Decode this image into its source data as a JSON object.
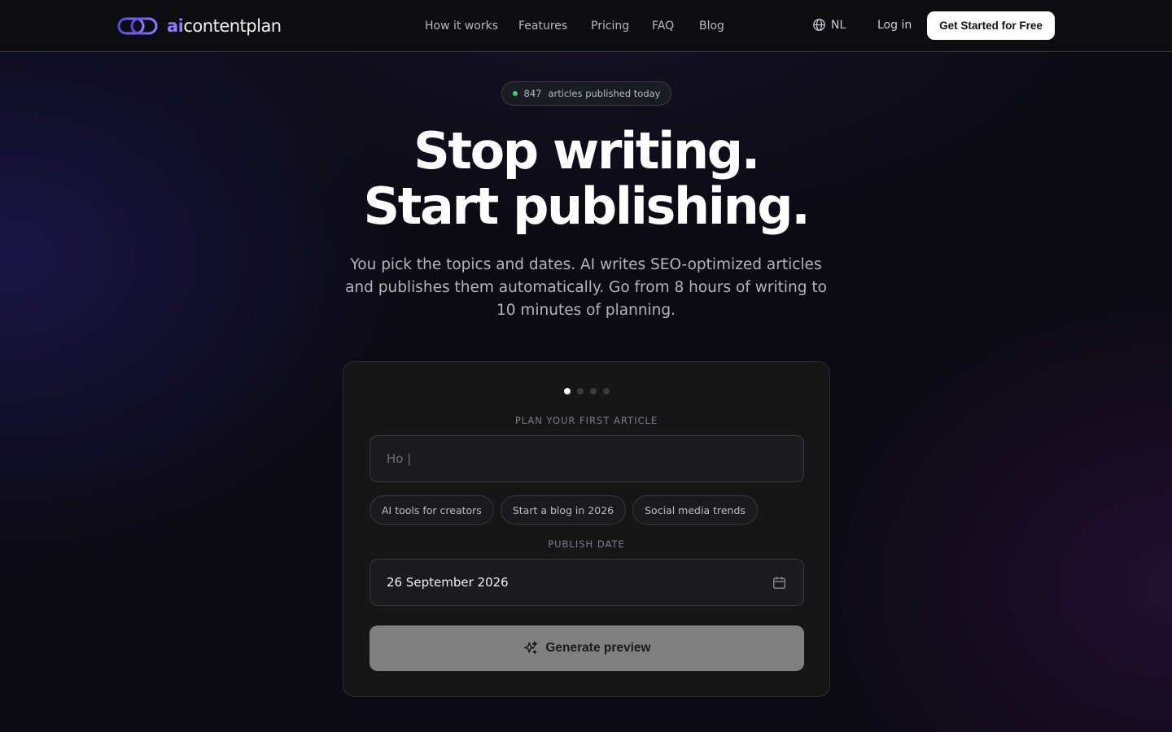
{
  "brand": {
    "prefix": "ai",
    "name": "contentplan",
    "accent": "#8b7bff"
  },
  "nav": {
    "items": [
      "How it works",
      "Features",
      "Pricing",
      "FAQ",
      "Blog"
    ],
    "language": "NL",
    "login": "Log in",
    "cta": "Get Started for Free"
  },
  "hero": {
    "badge_count": "847",
    "badge_text": "articles published today",
    "headline_line1": "Stop writing.",
    "headline_line2": "Start publishing.",
    "subtitle": "You pick the topics and dates. AI writes SEO-optimized articles and publishes them automatically. Go from 8 hours of writing to 10 minutes of planning."
  },
  "planner": {
    "steps_total": 4,
    "step_active": 1,
    "topic_label": "PLAN YOUR FIRST ARTICLE",
    "topic_value": "Ho |",
    "suggestions": [
      "AI tools for creators",
      "Start a blog in 2026",
      "Social media trends"
    ],
    "date_label": "PUBLISH DATE",
    "date_value": "26 September 2026",
    "generate_label": "Generate preview"
  },
  "icons": {
    "logo": "linked-rings-logo",
    "language": "globe-icon",
    "calendar": "calendar-icon",
    "generate": "sparkles-icon"
  }
}
